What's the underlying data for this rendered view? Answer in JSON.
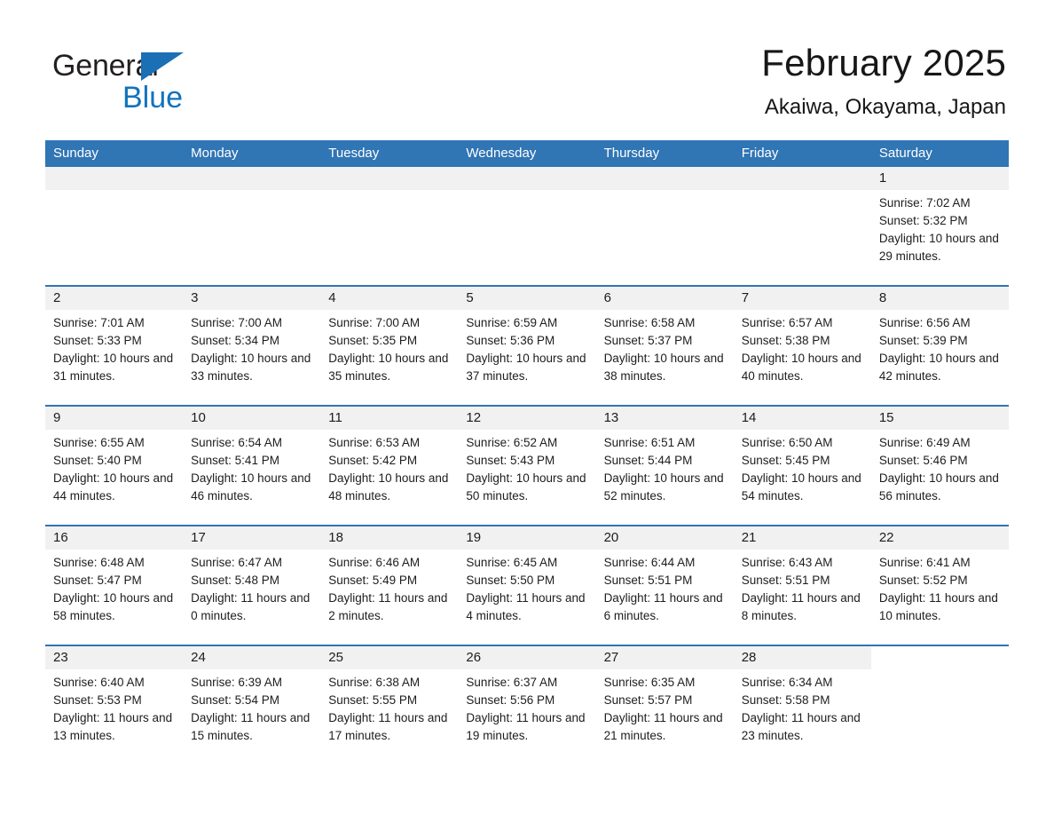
{
  "brand": {
    "word1": "General",
    "word2": "Blue",
    "triangle_color": "#1a6fb5",
    "word2_color": "#1273bd"
  },
  "header": {
    "title": "February 2025",
    "subtitle": "Akaiwa, Okayama, Japan"
  },
  "theme": {
    "header_blue": "#3075b4",
    "day_band_gray": "#f1f1f1",
    "row_divider_blue": "#3075b4",
    "text_color": "#1d1d1d"
  },
  "weekdays": [
    "Sunday",
    "Monday",
    "Tuesday",
    "Wednesday",
    "Thursday",
    "Friday",
    "Saturday"
  ],
  "labels": {
    "sunrise_prefix": "Sunrise:",
    "sunset_prefix": "Sunset:",
    "daylight_prefix": "Daylight:"
  },
  "weeks": [
    [
      {
        "day": "",
        "empty": true
      },
      {
        "day": "",
        "empty": true
      },
      {
        "day": "",
        "empty": true
      },
      {
        "day": "",
        "empty": true
      },
      {
        "day": "",
        "empty": true
      },
      {
        "day": "",
        "empty": true
      },
      {
        "day": "1",
        "sunrise": "Sunrise: 7:02 AM",
        "sunset": "Sunset: 5:32 PM",
        "daylight": "Daylight: 10 hours and 29 minutes."
      }
    ],
    [
      {
        "day": "2",
        "sunrise": "Sunrise: 7:01 AM",
        "sunset": "Sunset: 5:33 PM",
        "daylight": "Daylight: 10 hours and 31 minutes."
      },
      {
        "day": "3",
        "sunrise": "Sunrise: 7:00 AM",
        "sunset": "Sunset: 5:34 PM",
        "daylight": "Daylight: 10 hours and 33 minutes."
      },
      {
        "day": "4",
        "sunrise": "Sunrise: 7:00 AM",
        "sunset": "Sunset: 5:35 PM",
        "daylight": "Daylight: 10 hours and 35 minutes."
      },
      {
        "day": "5",
        "sunrise": "Sunrise: 6:59 AM",
        "sunset": "Sunset: 5:36 PM",
        "daylight": "Daylight: 10 hours and 37 minutes."
      },
      {
        "day": "6",
        "sunrise": "Sunrise: 6:58 AM",
        "sunset": "Sunset: 5:37 PM",
        "daylight": "Daylight: 10 hours and 38 minutes."
      },
      {
        "day": "7",
        "sunrise": "Sunrise: 6:57 AM",
        "sunset": "Sunset: 5:38 PM",
        "daylight": "Daylight: 10 hours and 40 minutes."
      },
      {
        "day": "8",
        "sunrise": "Sunrise: 6:56 AM",
        "sunset": "Sunset: 5:39 PM",
        "daylight": "Daylight: 10 hours and 42 minutes."
      }
    ],
    [
      {
        "day": "9",
        "sunrise": "Sunrise: 6:55 AM",
        "sunset": "Sunset: 5:40 PM",
        "daylight": "Daylight: 10 hours and 44 minutes."
      },
      {
        "day": "10",
        "sunrise": "Sunrise: 6:54 AM",
        "sunset": "Sunset: 5:41 PM",
        "daylight": "Daylight: 10 hours and 46 minutes."
      },
      {
        "day": "11",
        "sunrise": "Sunrise: 6:53 AM",
        "sunset": "Sunset: 5:42 PM",
        "daylight": "Daylight: 10 hours and 48 minutes."
      },
      {
        "day": "12",
        "sunrise": "Sunrise: 6:52 AM",
        "sunset": "Sunset: 5:43 PM",
        "daylight": "Daylight: 10 hours and 50 minutes."
      },
      {
        "day": "13",
        "sunrise": "Sunrise: 6:51 AM",
        "sunset": "Sunset: 5:44 PM",
        "daylight": "Daylight: 10 hours and 52 minutes."
      },
      {
        "day": "14",
        "sunrise": "Sunrise: 6:50 AM",
        "sunset": "Sunset: 5:45 PM",
        "daylight": "Daylight: 10 hours and 54 minutes."
      },
      {
        "day": "15",
        "sunrise": "Sunrise: 6:49 AM",
        "sunset": "Sunset: 5:46 PM",
        "daylight": "Daylight: 10 hours and 56 minutes."
      }
    ],
    [
      {
        "day": "16",
        "sunrise": "Sunrise: 6:48 AM",
        "sunset": "Sunset: 5:47 PM",
        "daylight": "Daylight: 10 hours and 58 minutes."
      },
      {
        "day": "17",
        "sunrise": "Sunrise: 6:47 AM",
        "sunset": "Sunset: 5:48 PM",
        "daylight": "Daylight: 11 hours and 0 minutes."
      },
      {
        "day": "18",
        "sunrise": "Sunrise: 6:46 AM",
        "sunset": "Sunset: 5:49 PM",
        "daylight": "Daylight: 11 hours and 2 minutes."
      },
      {
        "day": "19",
        "sunrise": "Sunrise: 6:45 AM",
        "sunset": "Sunset: 5:50 PM",
        "daylight": "Daylight: 11 hours and 4 minutes."
      },
      {
        "day": "20",
        "sunrise": "Sunrise: 6:44 AM",
        "sunset": "Sunset: 5:51 PM",
        "daylight": "Daylight: 11 hours and 6 minutes."
      },
      {
        "day": "21",
        "sunrise": "Sunrise: 6:43 AM",
        "sunset": "Sunset: 5:51 PM",
        "daylight": "Daylight: 11 hours and 8 minutes."
      },
      {
        "day": "22",
        "sunrise": "Sunrise: 6:41 AM",
        "sunset": "Sunset: 5:52 PM",
        "daylight": "Daylight: 11 hours and 10 minutes."
      }
    ],
    [
      {
        "day": "23",
        "sunrise": "Sunrise: 6:40 AM",
        "sunset": "Sunset: 5:53 PM",
        "daylight": "Daylight: 11 hours and 13 minutes."
      },
      {
        "day": "24",
        "sunrise": "Sunrise: 6:39 AM",
        "sunset": "Sunset: 5:54 PM",
        "daylight": "Daylight: 11 hours and 15 minutes."
      },
      {
        "day": "25",
        "sunrise": "Sunrise: 6:38 AM",
        "sunset": "Sunset: 5:55 PM",
        "daylight": "Daylight: 11 hours and 17 minutes."
      },
      {
        "day": "26",
        "sunrise": "Sunrise: 6:37 AM",
        "sunset": "Sunset: 5:56 PM",
        "daylight": "Daylight: 11 hours and 19 minutes."
      },
      {
        "day": "27",
        "sunrise": "Sunrise: 6:35 AM",
        "sunset": "Sunset: 5:57 PM",
        "daylight": "Daylight: 11 hours and 21 minutes."
      },
      {
        "day": "28",
        "sunrise": "Sunrise: 6:34 AM",
        "sunset": "Sunset: 5:58 PM",
        "daylight": "Daylight: 11 hours and 23 minutes."
      },
      {
        "day": "",
        "empty": true,
        "no_band": true
      }
    ]
  ]
}
